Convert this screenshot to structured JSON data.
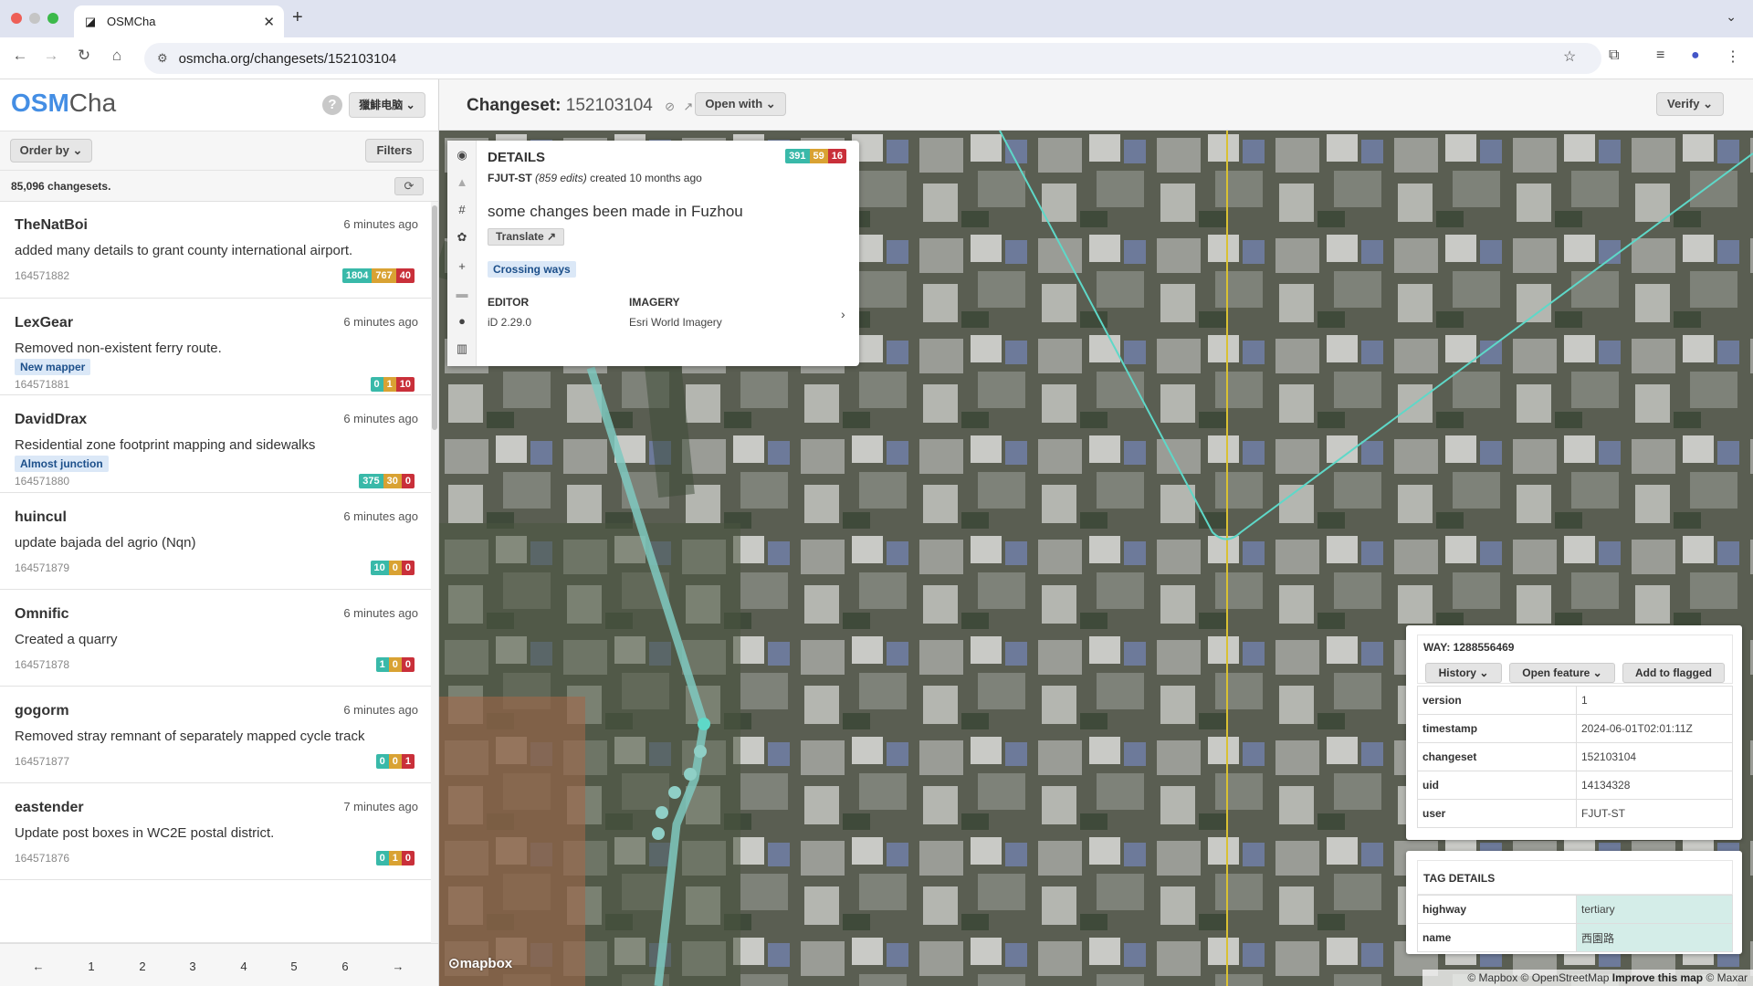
{
  "browser": {
    "tab_title": "OSMCha",
    "new_tab_icon": "plus-icon",
    "url": "osmcha.org/changesets/152103104"
  },
  "app": {
    "logo_osm": "OSM",
    "logo_cha": "Cha",
    "help_label": "?",
    "user_button": "獵鯡电脑",
    "order_by": "Order by",
    "filters": "Filters",
    "changeset_count": "85,096 changesets.",
    "colors": {
      "accent": "#448ee4",
      "added": "#39b9a9",
      "modified": "#d9a233",
      "deleted": "#c9303a",
      "tag_highlight": "#d4ede8"
    }
  },
  "changesets": [
    {
      "user": "TheNatBoi",
      "time": "6 minutes ago",
      "comment": "added many details to grant county international airport.",
      "flag": "",
      "id": "164571882",
      "counts": [
        "1804",
        "767",
        "40"
      ]
    },
    {
      "user": "LexGear",
      "time": "6 minutes ago",
      "comment": "Removed non-existent ferry route.",
      "flag": "New mapper",
      "id": "164571881",
      "counts": [
        "0",
        "1",
        "10"
      ]
    },
    {
      "user": "DavidDrax",
      "time": "6 minutes ago",
      "comment": "Residential zone footprint mapping and sidewalks",
      "flag": "Almost junction",
      "id": "164571880",
      "counts": [
        "375",
        "30",
        "0"
      ]
    },
    {
      "user": "huincul",
      "time": "6 minutes ago",
      "comment": "update bajada del agrio (Nqn)",
      "flag": "",
      "id": "164571879",
      "counts": [
        "10",
        "0",
        "0"
      ]
    },
    {
      "user": "Omnific",
      "time": "6 minutes ago",
      "comment": "Created a quarry",
      "flag": "",
      "id": "164571878",
      "counts": [
        "1",
        "0",
        "0"
      ]
    },
    {
      "user": "gogorm",
      "time": "6 minutes ago",
      "comment": "Removed stray remnant of separately mapped cycle track",
      "flag": "",
      "id": "164571877",
      "counts": [
        "0",
        "0",
        "1"
      ]
    },
    {
      "user": "eastender",
      "time": "7 minutes ago",
      "comment": "Update post boxes in WC2E postal district.",
      "flag": "",
      "id": "164571876",
      "counts": [
        "0",
        "1",
        "0"
      ]
    }
  ],
  "pager": {
    "prev": "←",
    "pages": [
      "1",
      "2",
      "3",
      "4",
      "5",
      "6"
    ],
    "next": "→"
  },
  "changeset": {
    "label": "Changeset:",
    "id": "152103104",
    "open_with": "Open with",
    "verify": "Verify"
  },
  "details": {
    "title": "DETAILS",
    "counts": [
      "391",
      "59",
      "16"
    ],
    "user": "FJUT-ST",
    "edits": "(859 edits)",
    "created": "created 10 months ago",
    "comment": "some changes been made in Fuzhou",
    "translate": "Translate",
    "reason": "Crossing ways",
    "editor_label": "EDITOR",
    "editor_value": "iD 2.29.0",
    "imagery_label": "IMAGERY",
    "imagery_value": "Esri World Imagery"
  },
  "feature": {
    "title": "WAY: 1288556469",
    "history": "History",
    "open_feature": "Open feature",
    "add_flagged": "Add to flagged",
    "props": [
      {
        "k": "version",
        "v": "1"
      },
      {
        "k": "timestamp",
        "v": "2024-06-01T02:01:11Z"
      },
      {
        "k": "changeset",
        "v": "152103104"
      },
      {
        "k": "uid",
        "v": "14134328"
      },
      {
        "k": "user",
        "v": "FJUT-ST"
      }
    ]
  },
  "tags": {
    "title": "TAG DETAILS",
    "rows": [
      {
        "k": "highway",
        "v": "tertiary"
      },
      {
        "k": "name",
        "v": "西園路"
      }
    ]
  },
  "map": {
    "logo": "mapbox",
    "attr_mapbox": "© Mapbox",
    "attr_osm": "© OpenStreetMap",
    "attr_improve": "Improve this map",
    "attr_maxar": "© Maxar"
  }
}
